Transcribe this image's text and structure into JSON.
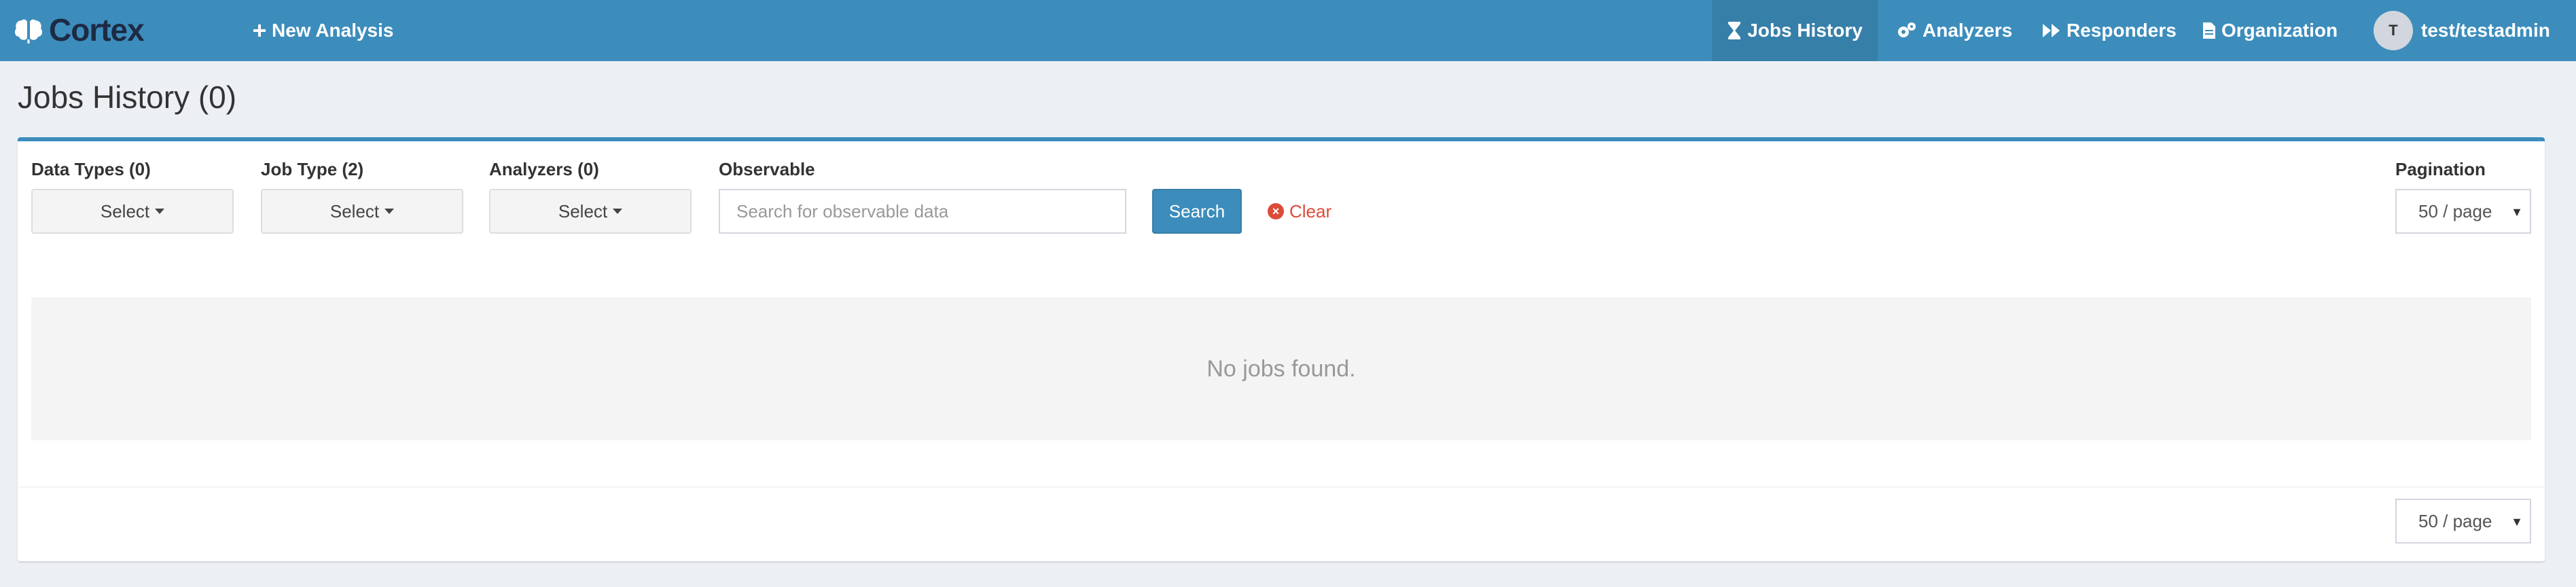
{
  "nav": {
    "brand": "Cortex",
    "new_analysis": "New Analysis",
    "jobs_history": "Jobs History",
    "analyzers": "Analyzers",
    "responders": "Responders",
    "organization": "Organization",
    "user_initial": "T",
    "user": "test/testadmin"
  },
  "page": {
    "title": "Jobs History (0)"
  },
  "filters": {
    "data_types_label": "Data Types (0)",
    "job_type_label": "Job Type (2)",
    "analyzers_label": "Analyzers (0)",
    "observable_label": "Observable",
    "select_label": "Select",
    "observable_placeholder": "Search for observable data",
    "observable_value": "",
    "search_button": "Search",
    "clear_button": "Clear",
    "pagination_label": "Pagination",
    "page_size": "50 / page"
  },
  "results": {
    "empty_message": "No jobs found."
  },
  "colors": {
    "nav_bg": "#3c8dbc",
    "nav_active": "#367fa9",
    "danger": "#dd4b39"
  }
}
